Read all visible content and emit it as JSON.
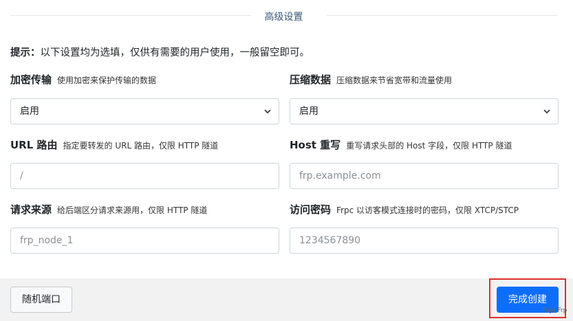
{
  "section": {
    "title": "高级设置"
  },
  "hint": {
    "prefix": "提示：",
    "text": "以下设置均为选填，仅供有需要的用户使用，一般留空即可。"
  },
  "fields": {
    "encryption": {
      "label": "加密传输",
      "desc": "使用加密来保护传输的数据",
      "value": "启用"
    },
    "compression": {
      "label": "压缩数据",
      "desc": "压缩数据来节省宽带和流量使用",
      "value": "启用"
    },
    "url_route": {
      "label": "URL 路由",
      "desc": "指定要转发的 URL 路由，仅限 HTTP 隧道",
      "placeholder": "/"
    },
    "host_rewrite": {
      "label": "Host 重写",
      "desc": "重写请求头部的 Host 字段，仅限 HTTP 隧道",
      "placeholder": "frp.example.com"
    },
    "request_source": {
      "label": "请求来源",
      "desc": "给后端区分请求来源用，仅限 HTTP 隧道",
      "placeholder": "frp_node_1"
    },
    "access_password": {
      "label": "访问密码",
      "desc": "Frpc 以访客模式连接时的密码，仅限 XTCP/STCP",
      "placeholder": "1234567890"
    }
  },
  "footer": {
    "random_port_label": "随机端口",
    "create_label": "完成创建"
  },
  "watermark": "Fuju Frp",
  "colors": {
    "primary": "#0d6efd",
    "highlight": "#d9302c",
    "footer_bg": "#f2f2f3"
  }
}
